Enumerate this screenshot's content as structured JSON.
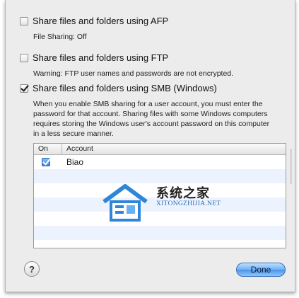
{
  "afp": {
    "label": "Share files and folders using AFP",
    "checked": false,
    "note": "File Sharing: Off"
  },
  "ftp": {
    "label": "Share files and folders using FTP",
    "checked": false,
    "note": "Warning: FTP user names and passwords are not encrypted."
  },
  "smb": {
    "label": "Share files and folders using SMB (Windows)",
    "checked": true,
    "note": "When you enable SMB sharing for a user account, you must enter the password for that account. Sharing files with some Windows computers requires storing the Windows user's account password on this computer in a less secure manner."
  },
  "table": {
    "columns": [
      "On",
      "Account"
    ],
    "rows": [
      {
        "on": true,
        "account": "Biao"
      }
    ]
  },
  "watermark": {
    "title": "系统之家",
    "subtitle": "XITONGZHIJIA.NET"
  },
  "help": {
    "label": "?"
  },
  "done": {
    "label": "Done"
  },
  "colors": {
    "accent": "#4d93e6",
    "row_alt": "#edf3fe",
    "sheet_bg": "#ececec"
  }
}
